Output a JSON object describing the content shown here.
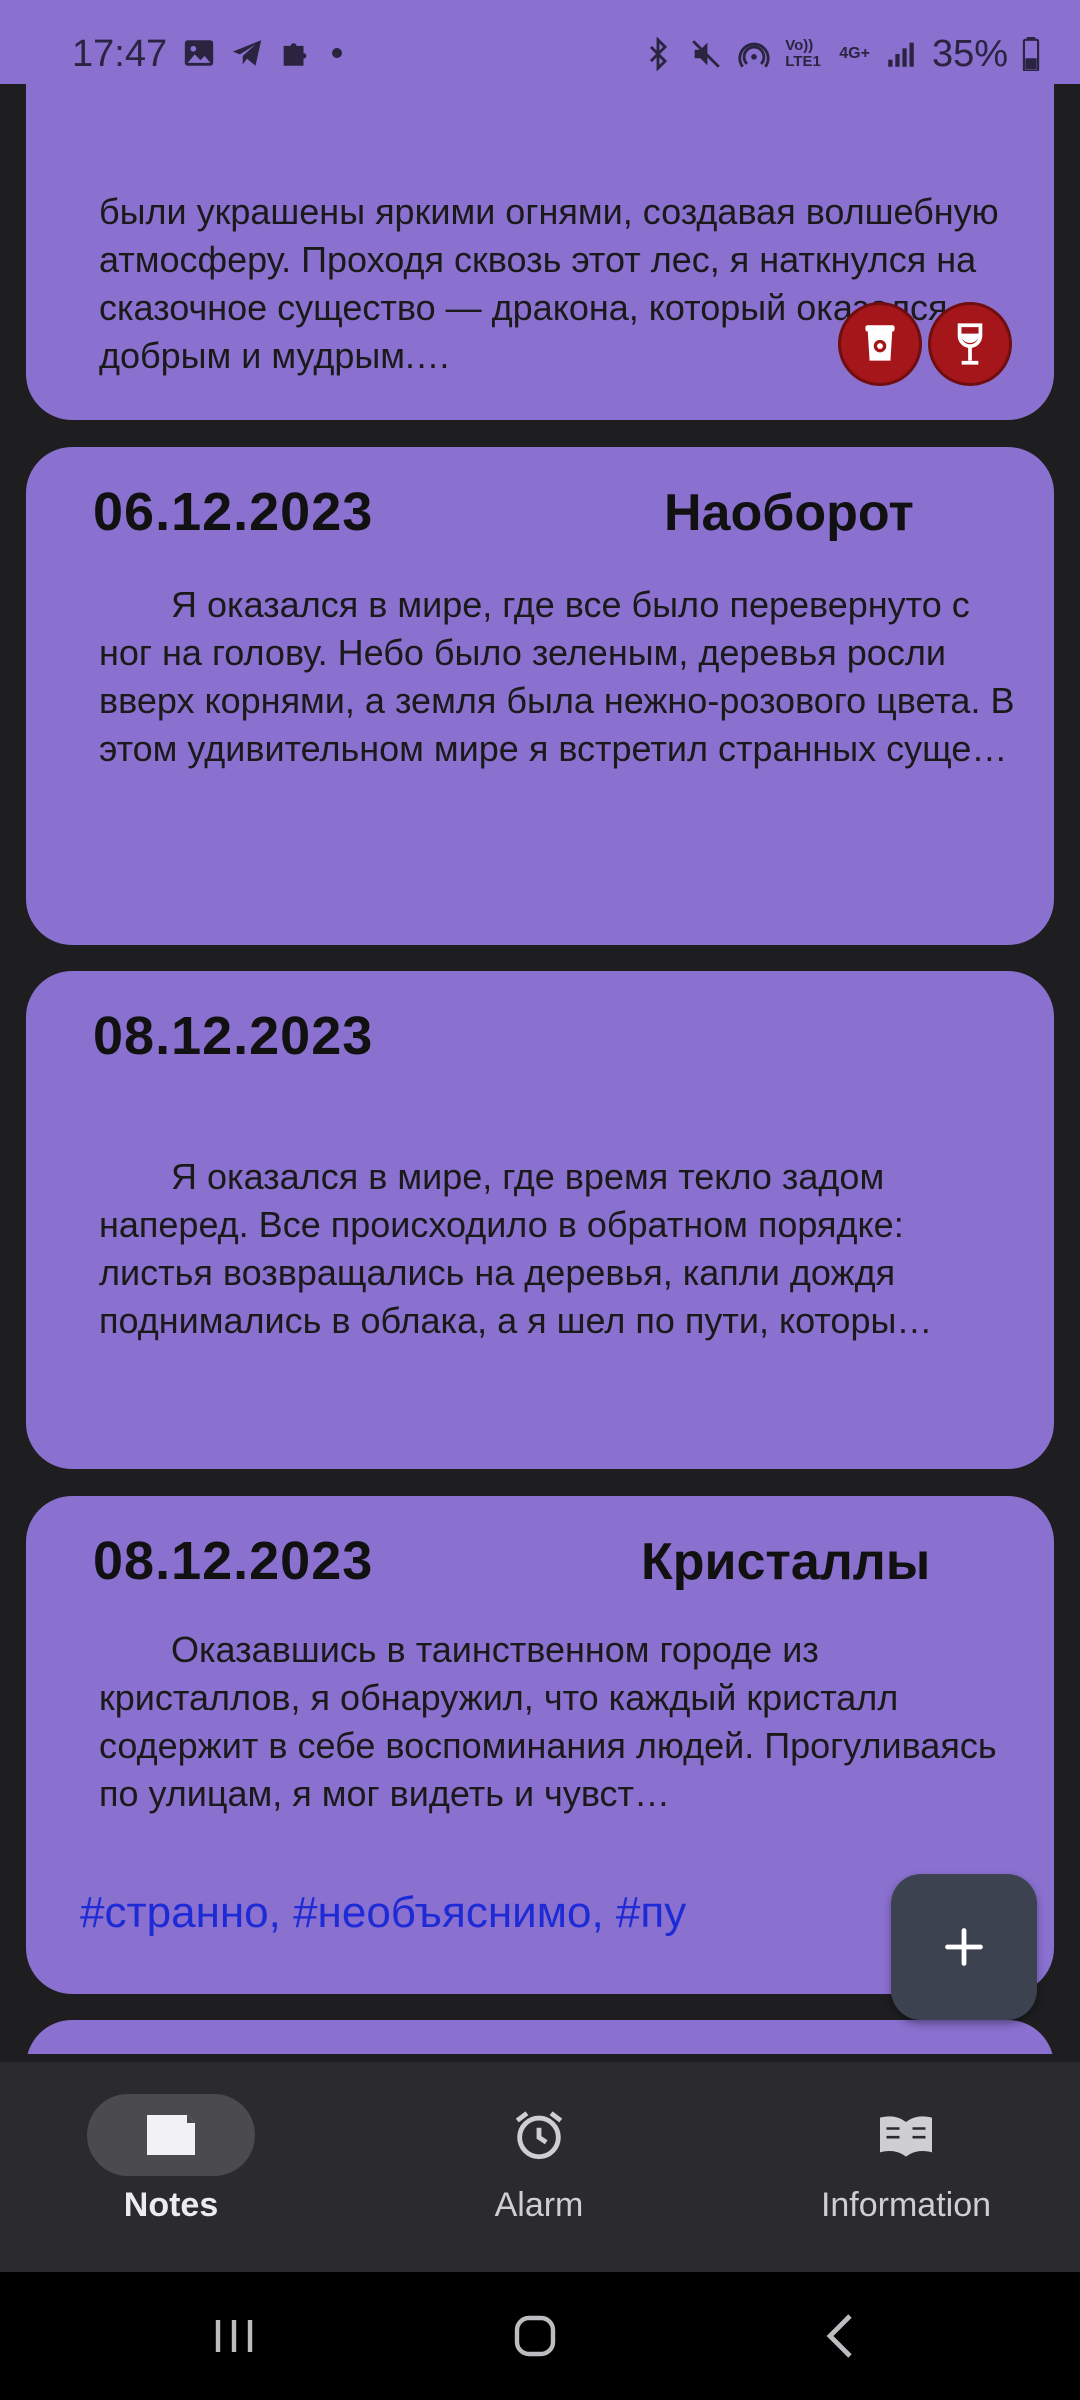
{
  "status_bar": {
    "time": "17:47",
    "left_icons": [
      "image-icon",
      "telegram-icon",
      "puzzle-icon",
      "dot-icon"
    ],
    "right_icons": [
      "bluetooth-icon",
      "mute-icon",
      "hotspot-icon",
      "volte-icon",
      "4g-icon",
      "signal-icon"
    ],
    "volte_label": "Vo)) LTE1",
    "network_label": "4G+",
    "battery": "35%"
  },
  "notes": [
    {
      "date": "",
      "title": "",
      "body": "были украшены яркими огнями, создавая волшебную атмосферу. Проходя сквозь этот лес, я наткнулся на сказочное существо — дракона, который оказался добрым и мудрым.…",
      "badges": [
        "coffee-cup-icon",
        "wine-glass-icon"
      ],
      "tags": ""
    },
    {
      "date": "06.12.2023",
      "title": "Наоборот",
      "body": "Я оказался в мире, где все было перевернуто с ног на голову. Небо было зеленым, деревья росли вверх корнями, а земля была нежно-розового цвета. В этом удивительном мире я встретил странных суще…",
      "badges": [],
      "tags": ""
    },
    {
      "date": "08.12.2023",
      "title": "",
      "body": "Я оказался в мире, где время текло задом наперед. Все происходило в обратном порядке: листья возвращались на деревья, капли дождя поднимались в облака, а я шел по пути, которы…",
      "badges": [],
      "tags": ""
    },
    {
      "date": "08.12.2023",
      "title": "Кристаллы",
      "body": "Оказавшись в таинственном городе из кристаллов, я обнаружил, что каждый кристалл содержит в себе воспоминания людей. Прогуливаясь по улицам, я мог видеть и чувст…",
      "badges": [],
      "tags": "#странно, #необъяснимо, #пу"
    }
  ],
  "fab": {
    "icon": "plus-icon"
  },
  "bottom_nav": {
    "items": [
      {
        "label": "Notes",
        "icon": "note-icon",
        "active": true
      },
      {
        "label": "Alarm",
        "icon": "alarm-icon",
        "active": false
      },
      {
        "label": "Information",
        "icon": "book-icon",
        "active": false
      }
    ]
  },
  "system_nav": [
    "recents-icon",
    "home-icon",
    "back-icon"
  ],
  "colors": {
    "card": "#8a70cf",
    "background": "#1e1e20",
    "tag": "#1d2bd6",
    "badge": "#a4161a",
    "fab": "#3d4250",
    "nav_bar": "#2b2b2d"
  }
}
